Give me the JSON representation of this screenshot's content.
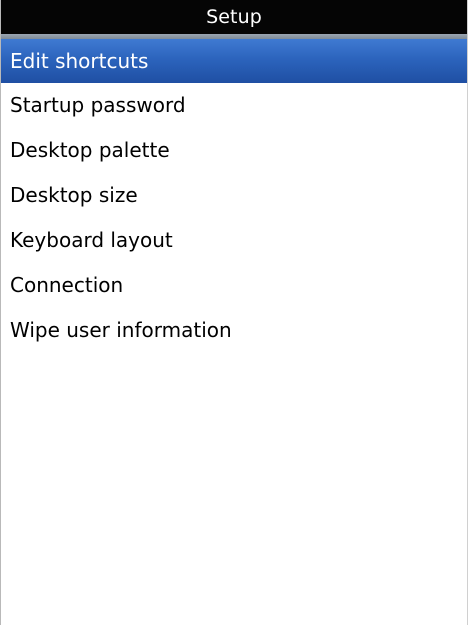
{
  "title_bar": {
    "title": "Setup"
  },
  "menu": {
    "selected_index": 0,
    "items": [
      {
        "label": "Edit shortcuts"
      },
      {
        "label": "Startup password"
      },
      {
        "label": "Desktop palette"
      },
      {
        "label": "Desktop size"
      },
      {
        "label": "Keyboard layout"
      },
      {
        "label": "Connection"
      },
      {
        "label": "Wipe user information"
      }
    ]
  },
  "colors": {
    "title_background": "#050505",
    "selection_highlight": "#2c64bd",
    "background": "#ffffff"
  }
}
